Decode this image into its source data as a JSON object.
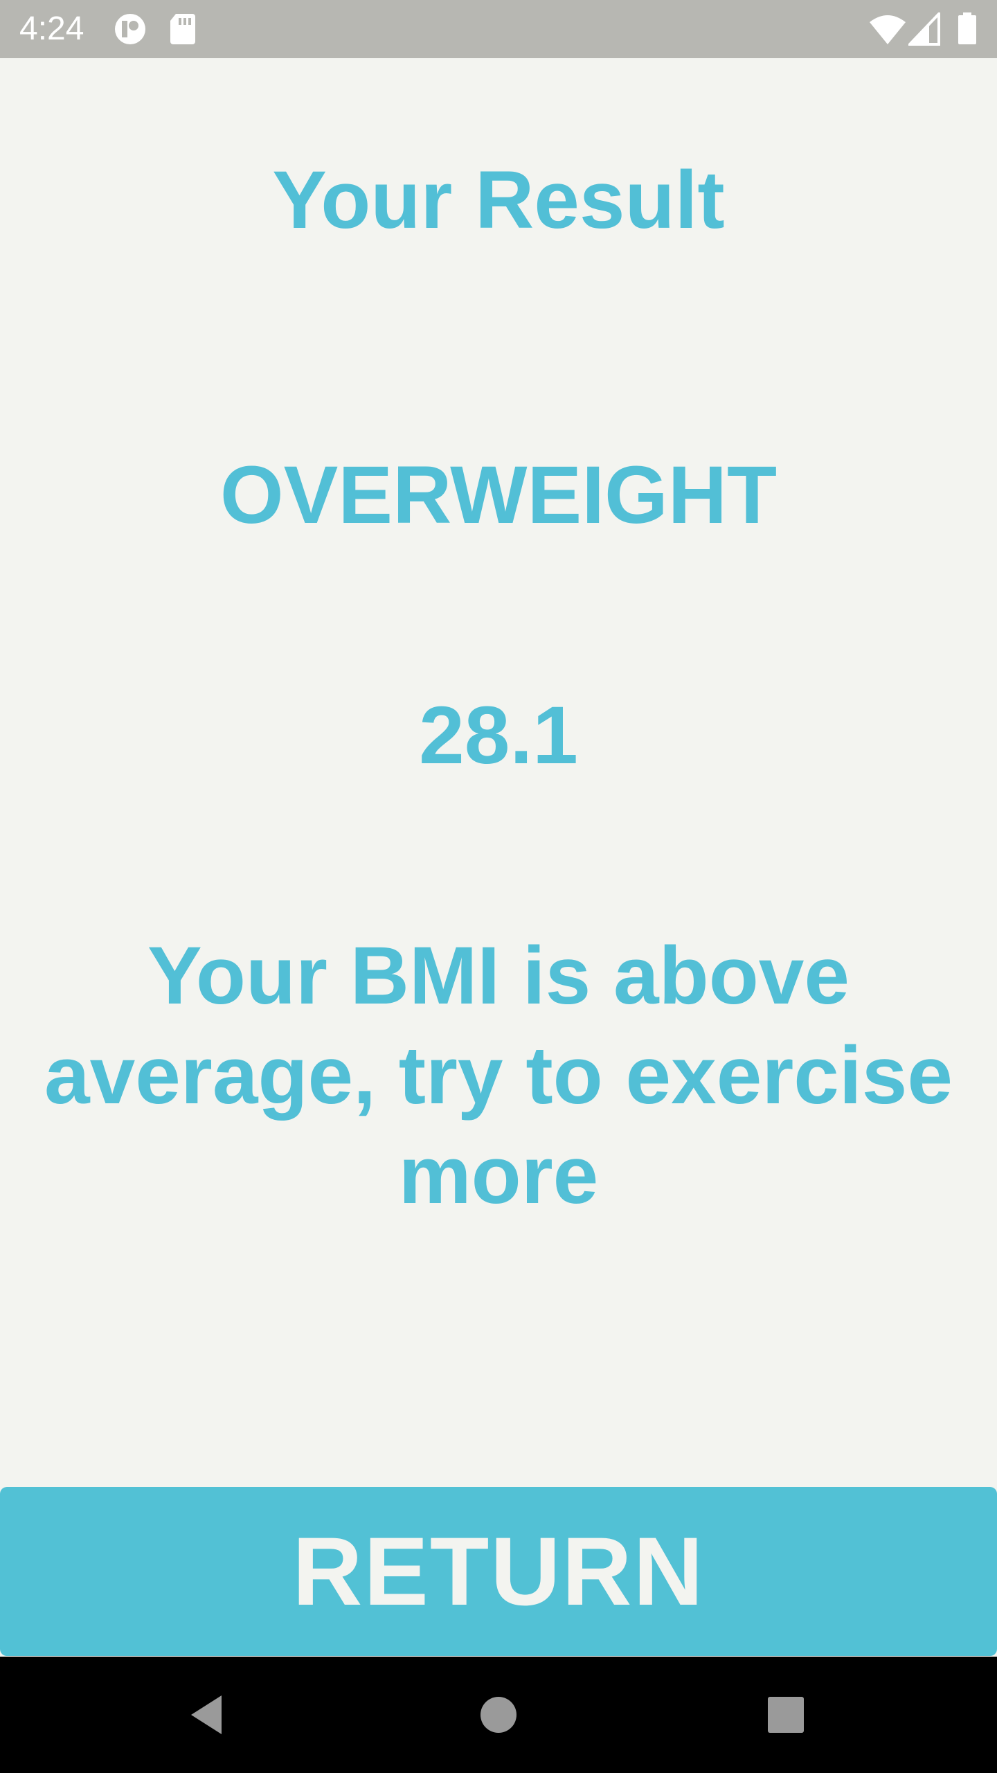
{
  "status_bar": {
    "time": "4:24",
    "icons": [
      "notification-app-icon",
      "sd-card-icon",
      "wifi-icon",
      "signal-icon",
      "battery-icon"
    ]
  },
  "result": {
    "title": "Your Result",
    "category": "OVERWEIGHT",
    "bmi": "28.1",
    "advice": "Your BMI is above average, try to exercise more"
  },
  "actions": {
    "return_label": "RETURN"
  },
  "nav_bar": {
    "buttons": [
      "back-icon",
      "home-icon",
      "recents-icon"
    ]
  },
  "colors": {
    "accent": "#52bfd6",
    "background": "#f3f4f0",
    "status_bar": "#b7b7b2",
    "nav_bar": "#000000"
  }
}
